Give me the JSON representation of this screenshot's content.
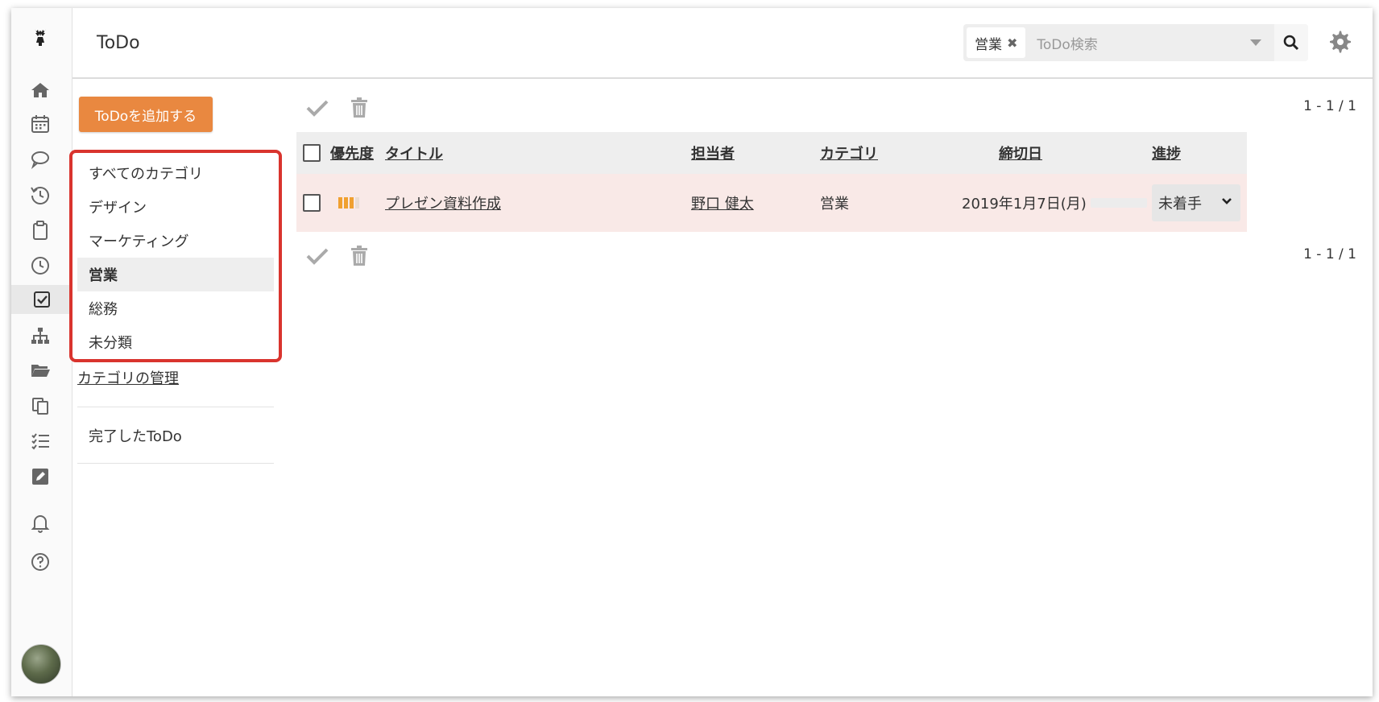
{
  "app": {
    "title": "ToDo"
  },
  "search": {
    "chip_label": "営業",
    "chip_remove": "✖",
    "placeholder": "ToDo検索"
  },
  "sidebar": {
    "icons": [
      "moose-logo-icon",
      "home-icon",
      "calendar-icon",
      "chat-icon",
      "history-icon",
      "clipboard-icon",
      "clock-icon",
      "todo-check-icon",
      "org-chart-icon",
      "folder-icon",
      "copy-icon",
      "checklist-icon",
      "edit-icon",
      "bell-icon",
      "help-icon"
    ]
  },
  "left": {
    "add_button": "ToDoを追加する",
    "categories": [
      {
        "label": "すべてのカテゴリ",
        "active": false
      },
      {
        "label": "デザイン",
        "active": false
      },
      {
        "label": "マーケティング",
        "active": false
      },
      {
        "label": "営業",
        "active": true
      },
      {
        "label": "総務",
        "active": false
      },
      {
        "label": "未分類",
        "active": false
      }
    ],
    "manage_link": "カテゴリの管理",
    "completed": "完了したToDo"
  },
  "pager": {
    "top": "1 - 1 / 1",
    "bottom": "1 - 1 / 1"
  },
  "table": {
    "headers": {
      "priority": "優先度",
      "title": "タイトル",
      "assignee": "担当者",
      "category": "カテゴリ",
      "due": "締切日",
      "progress": "進捗"
    },
    "rows": [
      {
        "priority_level": 3,
        "priority_max": 4,
        "title": "プレゼン資料作成",
        "assignee": "野口 健太",
        "category": "営業",
        "due": "2019年1月7日(月)",
        "progress_fraction": 0,
        "status": "未着手"
      }
    ]
  },
  "colors": {
    "accent": "#e98840",
    "highlight_box": "#d9342e",
    "row_bg": "#f9e9e7"
  }
}
